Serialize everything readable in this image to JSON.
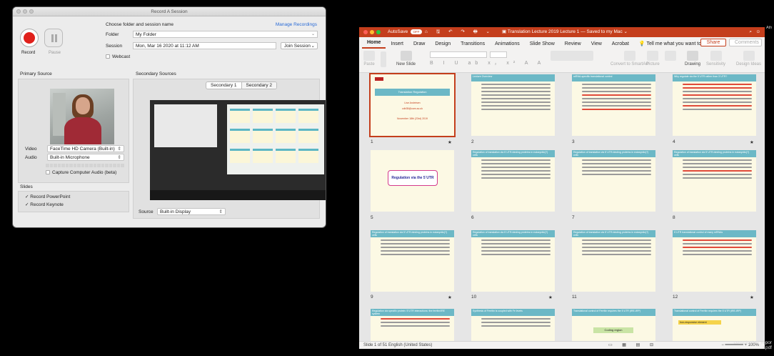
{
  "recorder": {
    "title": "Record A Session",
    "record_label": "Record",
    "pause_label": "Pause",
    "choose_label": "Choose folder and session name",
    "manage_label": "Manage Recordings",
    "folder_label": "Folder",
    "folder_value": "My Folder",
    "session_label": "Session",
    "session_value": "Mon, Mar 16 2020 at 11:12 AM",
    "join_label": "Join Session",
    "webcast_label": "Webcast",
    "primary_title": "Primary Source",
    "video_label": "Video",
    "video_value": "FaceTime HD Camera (Built-in)",
    "audio_label": "Audio",
    "audio_value": "Built-in Microphone",
    "capture_label": "Capture Computer Audio (beta)",
    "slides_title": "Slides",
    "record_powerpoint": "Record PowerPoint",
    "record_keynote": "Record Keynote",
    "secondary_title": "Secondary Sources",
    "tabs": [
      "Secondary 1",
      "Secondary 2"
    ],
    "source_label": "Source",
    "source_value": "Built-in Display"
  },
  "ppt": {
    "autosave_label": "AutoSave",
    "autosave_state": "OFF",
    "quick_icons": "⌂ 🖫 ↶ ↷ 🖶 ⌄",
    "doc_title": "Translation Lecture 2019 Lecture 1 — Saved to my Mac ⌄",
    "tabs": [
      "Home",
      "Insert",
      "Draw",
      "Design",
      "Transitions",
      "Animations",
      "Slide Show",
      "Review",
      "View",
      "Acrobat"
    ],
    "tell_me": "Tell me what you want to do",
    "share_label": "Share",
    "comments_label": "Comments",
    "ribbon": {
      "paste": "Paste",
      "new_slide": "New Slide",
      "convert": "Convert to SmartArt",
      "picture": "Picture",
      "drawing": "Drawing",
      "sensitivity": "Sensitivity",
      "design_ideas": "Design Ideas"
    },
    "slides": {
      "s1_title": "Translation Regulation",
      "s1_name": "Lise Andrésen",
      "s1_email": "cdb35@cam.ac.uk",
      "s1_date": "November 18th (23rd) 2019",
      "s5_text": "Regulation via the 5´UTR",
      "headers": [
        "Lecture Overview",
        "mRNA-specific translational control",
        "Why regulate via the 5´UTR rather than 3´UTR?",
        "Regulation of translation via 5´UTR-binding proteins in eukaryotic(?) cells",
        "Regulation of translation via 5´UTR-binding proteins in eukaryotic(?) cells",
        "Regulation of translation via 5´UTR-binding proteins in eukaryotic(?) cells",
        "Regulation of translation via 5´UTR-binding proteins in eukaryotic(?) cells",
        "Regulation of translation via 5´UTR-binding proteins in eukaryotic(?) cells",
        "Regulation of translation via 5´UTR-binding proteins in eukaryotic(?) cells",
        "5´UTR translational control of many mRNAs",
        "Regulation via specific protein: 5´UTR interactions: the ferritin/IRE system",
        "Synthesis of Ferritin is coupled with Fe levels",
        "Translational control of Ferritin requires the 5´UTR (IRE-IRP)",
        "Translational control of Ferritin requires the 5´UTR (IRE-IRP)"
      ],
      "s12_title": "Iron-responsive element",
      "coding_region": "Coding region",
      "numbers": [
        "1",
        "2",
        "3",
        "4",
        "5",
        "6",
        "7",
        "8",
        "9",
        "10",
        "11",
        "12"
      ],
      "star": "★"
    },
    "status_left": "Slide 1 of 51   English (United States)",
    "zoom": "100%"
  },
  "desktop": {
    "consultation": "consultation_repor",
    "consult_sub": "t.pdf"
  }
}
